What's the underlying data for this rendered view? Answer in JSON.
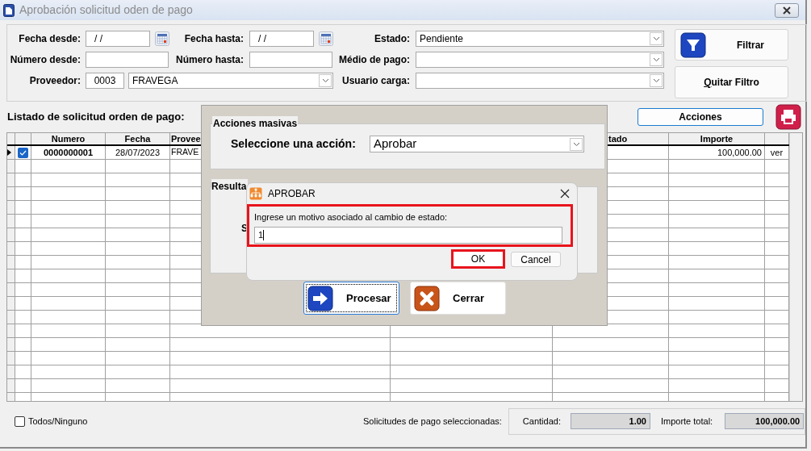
{
  "window": {
    "title": "Aprobación solicitud oden de pago"
  },
  "filters": {
    "fecha_desde": {
      "label": "Fecha desde:",
      "value": "/ /"
    },
    "fecha_hasta": {
      "label": "Fecha hasta:",
      "value": "/ /"
    },
    "estado": {
      "label": "Estado:",
      "value": "Pendiente"
    },
    "numero_desde": {
      "label": "Número desde:"
    },
    "numero_hasta": {
      "label": "Número hasta:"
    },
    "medio_pago": {
      "label": "Médio de pago:"
    },
    "proveedor": {
      "label": "Proveedor:",
      "code": "0003",
      "name": "FRAVEGA"
    },
    "usuario_carga": {
      "label": "Usuario carga:"
    },
    "filter_button": "Filtrar",
    "clear_button": "Quitar Filtro"
  },
  "list": {
    "title": "Listado de solicitud orden de pago:",
    "actions_button": "Acciones",
    "columns": [
      "Numero",
      "Fecha",
      "Provee",
      "tado",
      "Importe"
    ],
    "rows": [
      {
        "selected": true,
        "checked": true,
        "numero": "0000000001",
        "fecha": "28/07/2023",
        "proveedor": "FRAVE",
        "importe": "100,000.00",
        "link": "ver"
      }
    ]
  },
  "footer": {
    "all_none": {
      "label": "Todos/Ninguno",
      "checked": false
    },
    "selected_label": "Solicitudes de pago seleccionadas:",
    "cantidad_label": "Cantidad:",
    "cantidad": "1.00",
    "importe_label": "Importe total:",
    "importe": "100,000.00"
  },
  "mass_actions": {
    "group_title": "Acciones masivas",
    "select_label": "Seleccione una acción:",
    "action": "Aprobar",
    "result_title": "Resulta",
    "result_text": "S",
    "buttons": [
      {
        "label": "Procesar",
        "kind": "process",
        "focused": true
      },
      {
        "label": "Cerrar",
        "kind": "close",
        "focused": false
      }
    ]
  },
  "prompt": {
    "title": "APROBAR",
    "message": "Ingrese un motivo asociado al cambio de estado:",
    "value": "1",
    "ok": "OK",
    "cancel": "Cancel"
  }
}
